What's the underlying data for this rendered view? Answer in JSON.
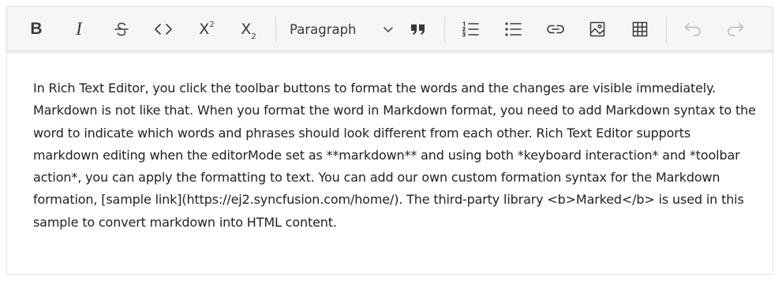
{
  "toolbar": {
    "bold": "B",
    "italic": "I",
    "superscript": {
      "base": "X",
      "mark": "2"
    },
    "subscript": {
      "base": "X",
      "mark": "2"
    },
    "format_value": "Paragraph",
    "blockquote_glyph": "❞",
    "icons": [
      "bold-icon",
      "italic-icon",
      "strikethrough-icon",
      "code-icon",
      "superscript-icon",
      "subscript-icon",
      "chevron-down-icon",
      "blockquote-icon",
      "ordered-list-icon",
      "unordered-list-icon",
      "link-icon",
      "image-icon",
      "table-icon",
      "undo-icon",
      "redo-icon"
    ]
  },
  "editor": {
    "content": "In Rich Text Editor, you click the toolbar buttons to format the words and the changes are visible immediately. Markdown is not like that. When you format the word in Markdown format, you need to add Markdown syntax to the word to indicate which words and phrases should look different from each other. Rich Text Editor supports markdown editing when the editorMode set as **markdown** and using both *keyboard interaction* and *toolbar action*, you can apply the formatting to text. You can add our own custom formation syntax for the Markdown formation, [sample link](https://ej2.syncfusion.com/home/). The third-party library <b>Marked</b> is used in this sample to convert markdown into HTML content."
  },
  "colors": {
    "toolbar_bg": "#f7f6f5",
    "icon": "#3a3a3a",
    "icon_disabled": "#b9b9b9",
    "text": "#222222",
    "border": "#e3e3e3"
  }
}
